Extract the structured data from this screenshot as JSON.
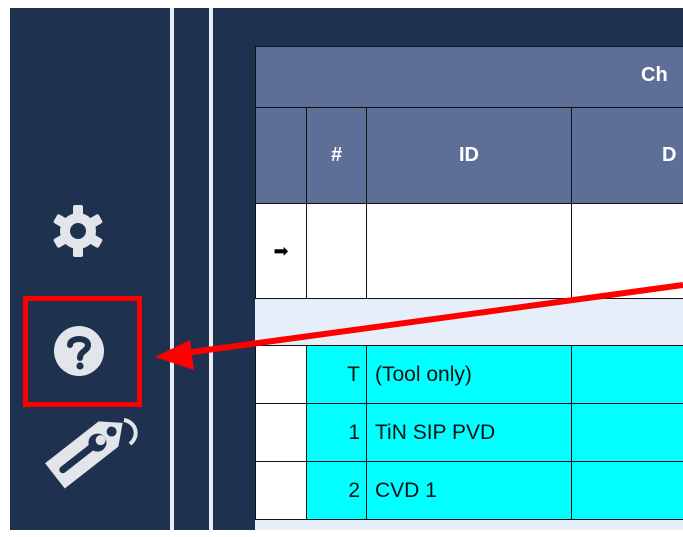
{
  "sidebar": {
    "icons": [
      "gear-icon",
      "help-icon",
      "tag-wrench-icon"
    ]
  },
  "table": {
    "title": "Ch",
    "headers": [
      "",
      "#",
      "ID",
      "D"
    ],
    "new_row_marker": "➡",
    "rows": [
      {
        "num": "T",
        "id": "(Tool only)"
      },
      {
        "num": "1",
        "id": "TiN SIP PVD"
      },
      {
        "num": "2",
        "id": "CVD 1"
      }
    ]
  },
  "colors": {
    "background": "#1e3250",
    "header": "#5d6f96",
    "row_highlight": "#00ffff",
    "annotation": "#ff0000"
  }
}
